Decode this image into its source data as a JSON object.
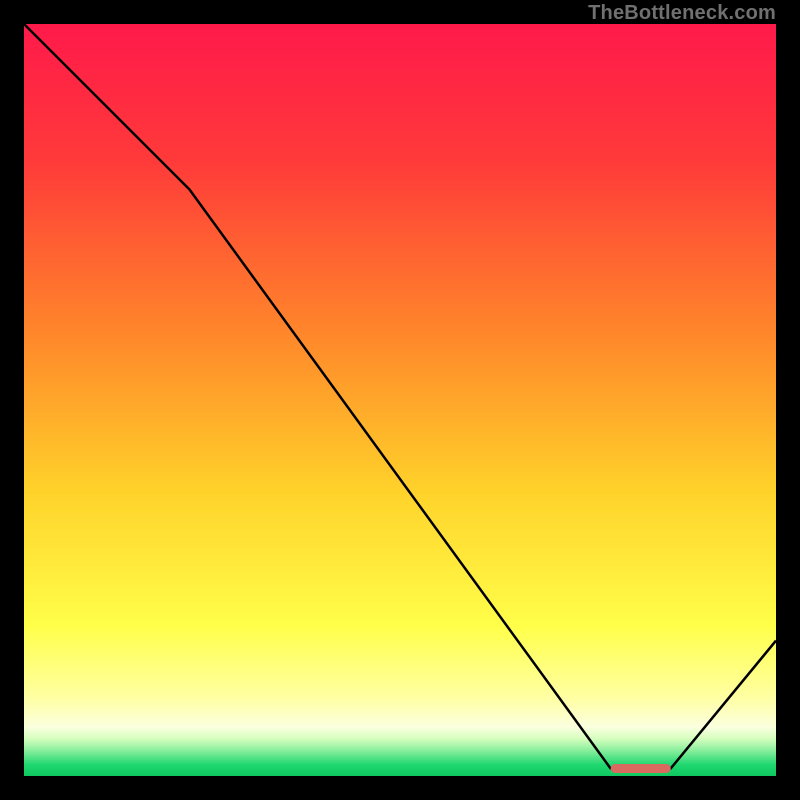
{
  "watermark": "TheBottleneck.com",
  "chart_data": {
    "type": "line",
    "title": "",
    "xlabel": "",
    "ylabel": "",
    "xlim": [
      0,
      100
    ],
    "ylim": [
      0,
      100
    ],
    "grid": false,
    "legend": false,
    "series": [
      {
        "name": "curve",
        "x": [
          0,
          22,
          78,
          86,
          100
        ],
        "y": [
          100,
          78,
          1,
          1,
          18
        ]
      }
    ],
    "marker": {
      "name": "highlight-bar",
      "x_start": 78,
      "x_end": 86,
      "y": 1,
      "color": "#d96a5f",
      "thickness": 1.2
    },
    "background_gradient": {
      "stops": [
        {
          "pos": 0.0,
          "color": "#ff1a4b"
        },
        {
          "pos": 0.18,
          "color": "#ff3a3a"
        },
        {
          "pos": 0.42,
          "color": "#ff8a2a"
        },
        {
          "pos": 0.62,
          "color": "#ffd22a"
        },
        {
          "pos": 0.8,
          "color": "#ffff4a"
        },
        {
          "pos": 0.9,
          "color": "#ffffa8"
        },
        {
          "pos": 0.935,
          "color": "#fbffe0"
        },
        {
          "pos": 0.95,
          "color": "#d8ffc0"
        },
        {
          "pos": 0.965,
          "color": "#8ff0a0"
        },
        {
          "pos": 0.985,
          "color": "#20d870"
        },
        {
          "pos": 1.0,
          "color": "#10c860"
        }
      ]
    }
  }
}
